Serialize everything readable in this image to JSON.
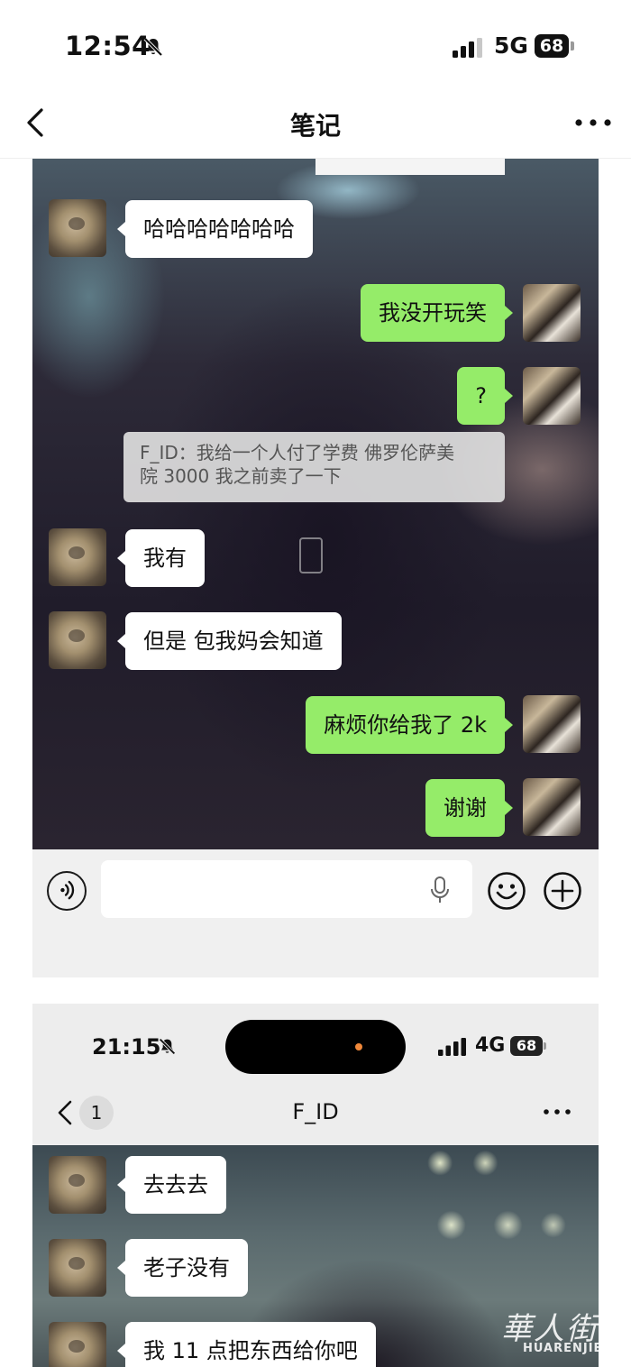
{
  "status_bar": {
    "time": "12:54",
    "network": "5G",
    "battery": "68"
  },
  "nav": {
    "title": "笔记"
  },
  "shot1": {
    "messages": [
      {
        "side": "left",
        "text": "哈哈哈哈哈哈哈"
      },
      {
        "side": "right",
        "text": "我没开玩笑"
      },
      {
        "side": "right",
        "text": "?"
      },
      {
        "side": "left",
        "text": "我有"
      },
      {
        "side": "left",
        "text": "但是 包我妈会知道"
      },
      {
        "side": "right",
        "text": "麻烦你给我了 2k"
      },
      {
        "side": "right",
        "text": "谢谢"
      }
    ],
    "quote": {
      "line1": "F_ID：我给一个人付了学费 佛罗伦萨美",
      "line2": "院 3000 我之前卖了一下"
    }
  },
  "shot2": {
    "time": "21:15",
    "network": "4G",
    "battery": "68",
    "unread_badge": "1",
    "chat_title": "F_ID",
    "messages": [
      {
        "side": "left",
        "text": "去去去"
      },
      {
        "side": "left",
        "text": "老子没有"
      },
      {
        "side": "left",
        "text": "我 11 点把东西给你吧"
      }
    ]
  },
  "watermark": {
    "cn": "華人街",
    "en": "HUARENJIE"
  },
  "icons": {
    "back": "chevron-left-icon",
    "more": "more-horizontal-icon",
    "voice": "voice-icon",
    "mic": "microphone-icon",
    "emoji": "emoji-icon",
    "plus": "plus-icon",
    "mute": "bell-slash-icon"
  },
  "colors": {
    "green_bubble": "#95ec69",
    "white_bubble": "#ffffff",
    "input_bar": "#f0f0f0"
  }
}
